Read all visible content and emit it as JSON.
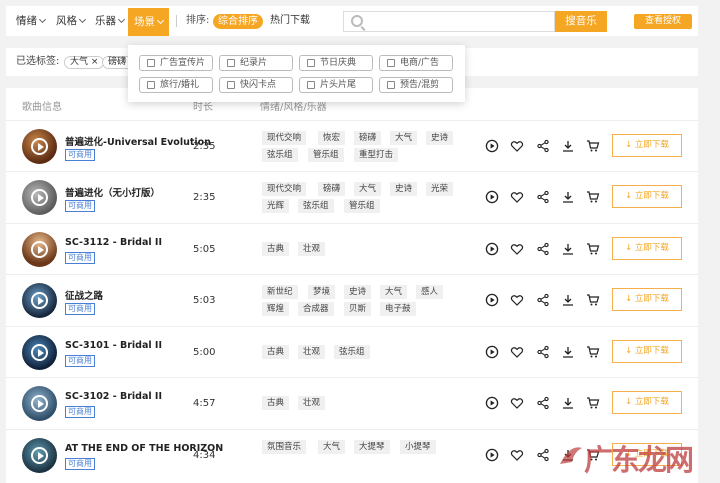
{
  "nav": {
    "mood": "情绪",
    "style": "风格",
    "instrument": "乐器",
    "scene": "场景",
    "sort_label": "排序:",
    "sort_active": "综合排序",
    "sort_other": "热门下载",
    "search_placeholder": "",
    "search_button": "搜音乐",
    "license_button": "查看授权"
  },
  "selected_tags": {
    "label": "已选标签:",
    "items": [
      {
        "text": "大气 ×"
      },
      {
        "text": "磅礴 ×"
      }
    ]
  },
  "scene_dropdown": [
    {
      "label": "广告宣传片"
    },
    {
      "label": "纪录片"
    },
    {
      "label": "节日庆典"
    },
    {
      "label": "电商/广告"
    },
    {
      "label": "旅行/婚礼"
    },
    {
      "label": "快闪卡点"
    },
    {
      "label": "片头片尾"
    },
    {
      "label": "预告/混剪"
    }
  ],
  "headers": {
    "song": "歌曲信息",
    "duration": "时长",
    "tags": "情绪/风格/乐器"
  },
  "download_label": "↓ 立即下载",
  "songs": [
    {
      "title": "普遍进化-Universal Evolution",
      "badge": "可商用",
      "duration": "2:35",
      "tags": [
        "现代交响",
        "恢宏",
        "磅礴",
        "大气",
        "史诗",
        "弦乐组",
        "管乐组",
        "重型打击"
      ]
    },
    {
      "title": "普遍进化（无小打版）",
      "badge": "可商用",
      "duration": "2:35",
      "tags": [
        "现代交响",
        "磅礴",
        "大气",
        "史诗",
        "光荣",
        "光辉",
        "弦乐组",
        "管乐组"
      ]
    },
    {
      "title": "SC-3112 - Bridal II",
      "badge": "可商用",
      "duration": "5:05",
      "tags": [
        "古典",
        "壮观"
      ]
    },
    {
      "title": "征战之路",
      "badge": "可商用",
      "duration": "5:03",
      "tags": [
        "新世纪",
        "梦境",
        "史诗",
        "大气",
        "感人",
        "辉煌",
        "合成器",
        "贝斯",
        "电子鼓"
      ]
    },
    {
      "title": "SC-3101 - Bridal II",
      "badge": "可商用",
      "duration": "5:00",
      "tags": [
        "古典",
        "壮观",
        "弦乐组"
      ]
    },
    {
      "title": "SC-3102 - Bridal II",
      "badge": "可商用",
      "duration": "4:57",
      "tags": [
        "古典",
        "壮观"
      ]
    },
    {
      "title": "AT THE END OF THE HORIZON",
      "badge": "可商用",
      "duration": "4:34",
      "tags": [
        "氛围音乐",
        "大气",
        "大提琴",
        "小提琴"
      ]
    }
  ],
  "watermark": "广东龙网"
}
